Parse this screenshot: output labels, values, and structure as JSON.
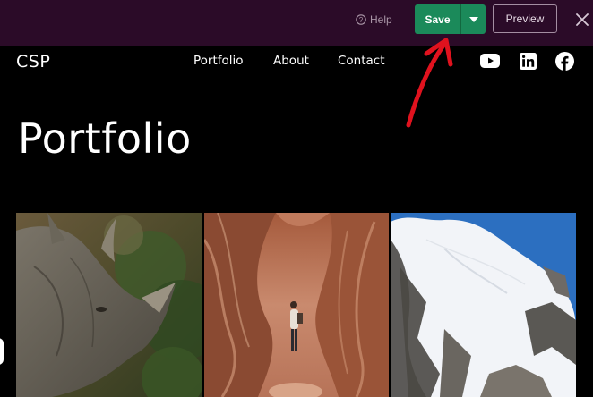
{
  "editor_bar": {
    "help_label": "Help",
    "save_label": "Save",
    "preview_label": "Preview",
    "icons": {
      "help": "help-circle-icon",
      "caret": "caret-down-icon",
      "close": "close-icon"
    }
  },
  "site": {
    "logo": "CSP",
    "nav": [
      "Portfolio",
      "About",
      "Contact"
    ],
    "social": [
      "youtube-icon",
      "linkedin-icon",
      "facebook-icon"
    ]
  },
  "page": {
    "title": "Portfolio",
    "gallery": [
      {
        "subject": "rhino"
      },
      {
        "subject": "canyon"
      },
      {
        "subject": "mountain"
      }
    ]
  },
  "colors": {
    "editor_bar_bg": "#2b0b28",
    "save_green": "#1b8a5a",
    "page_bg": "#000000",
    "annotation_red": "#e0121e"
  }
}
